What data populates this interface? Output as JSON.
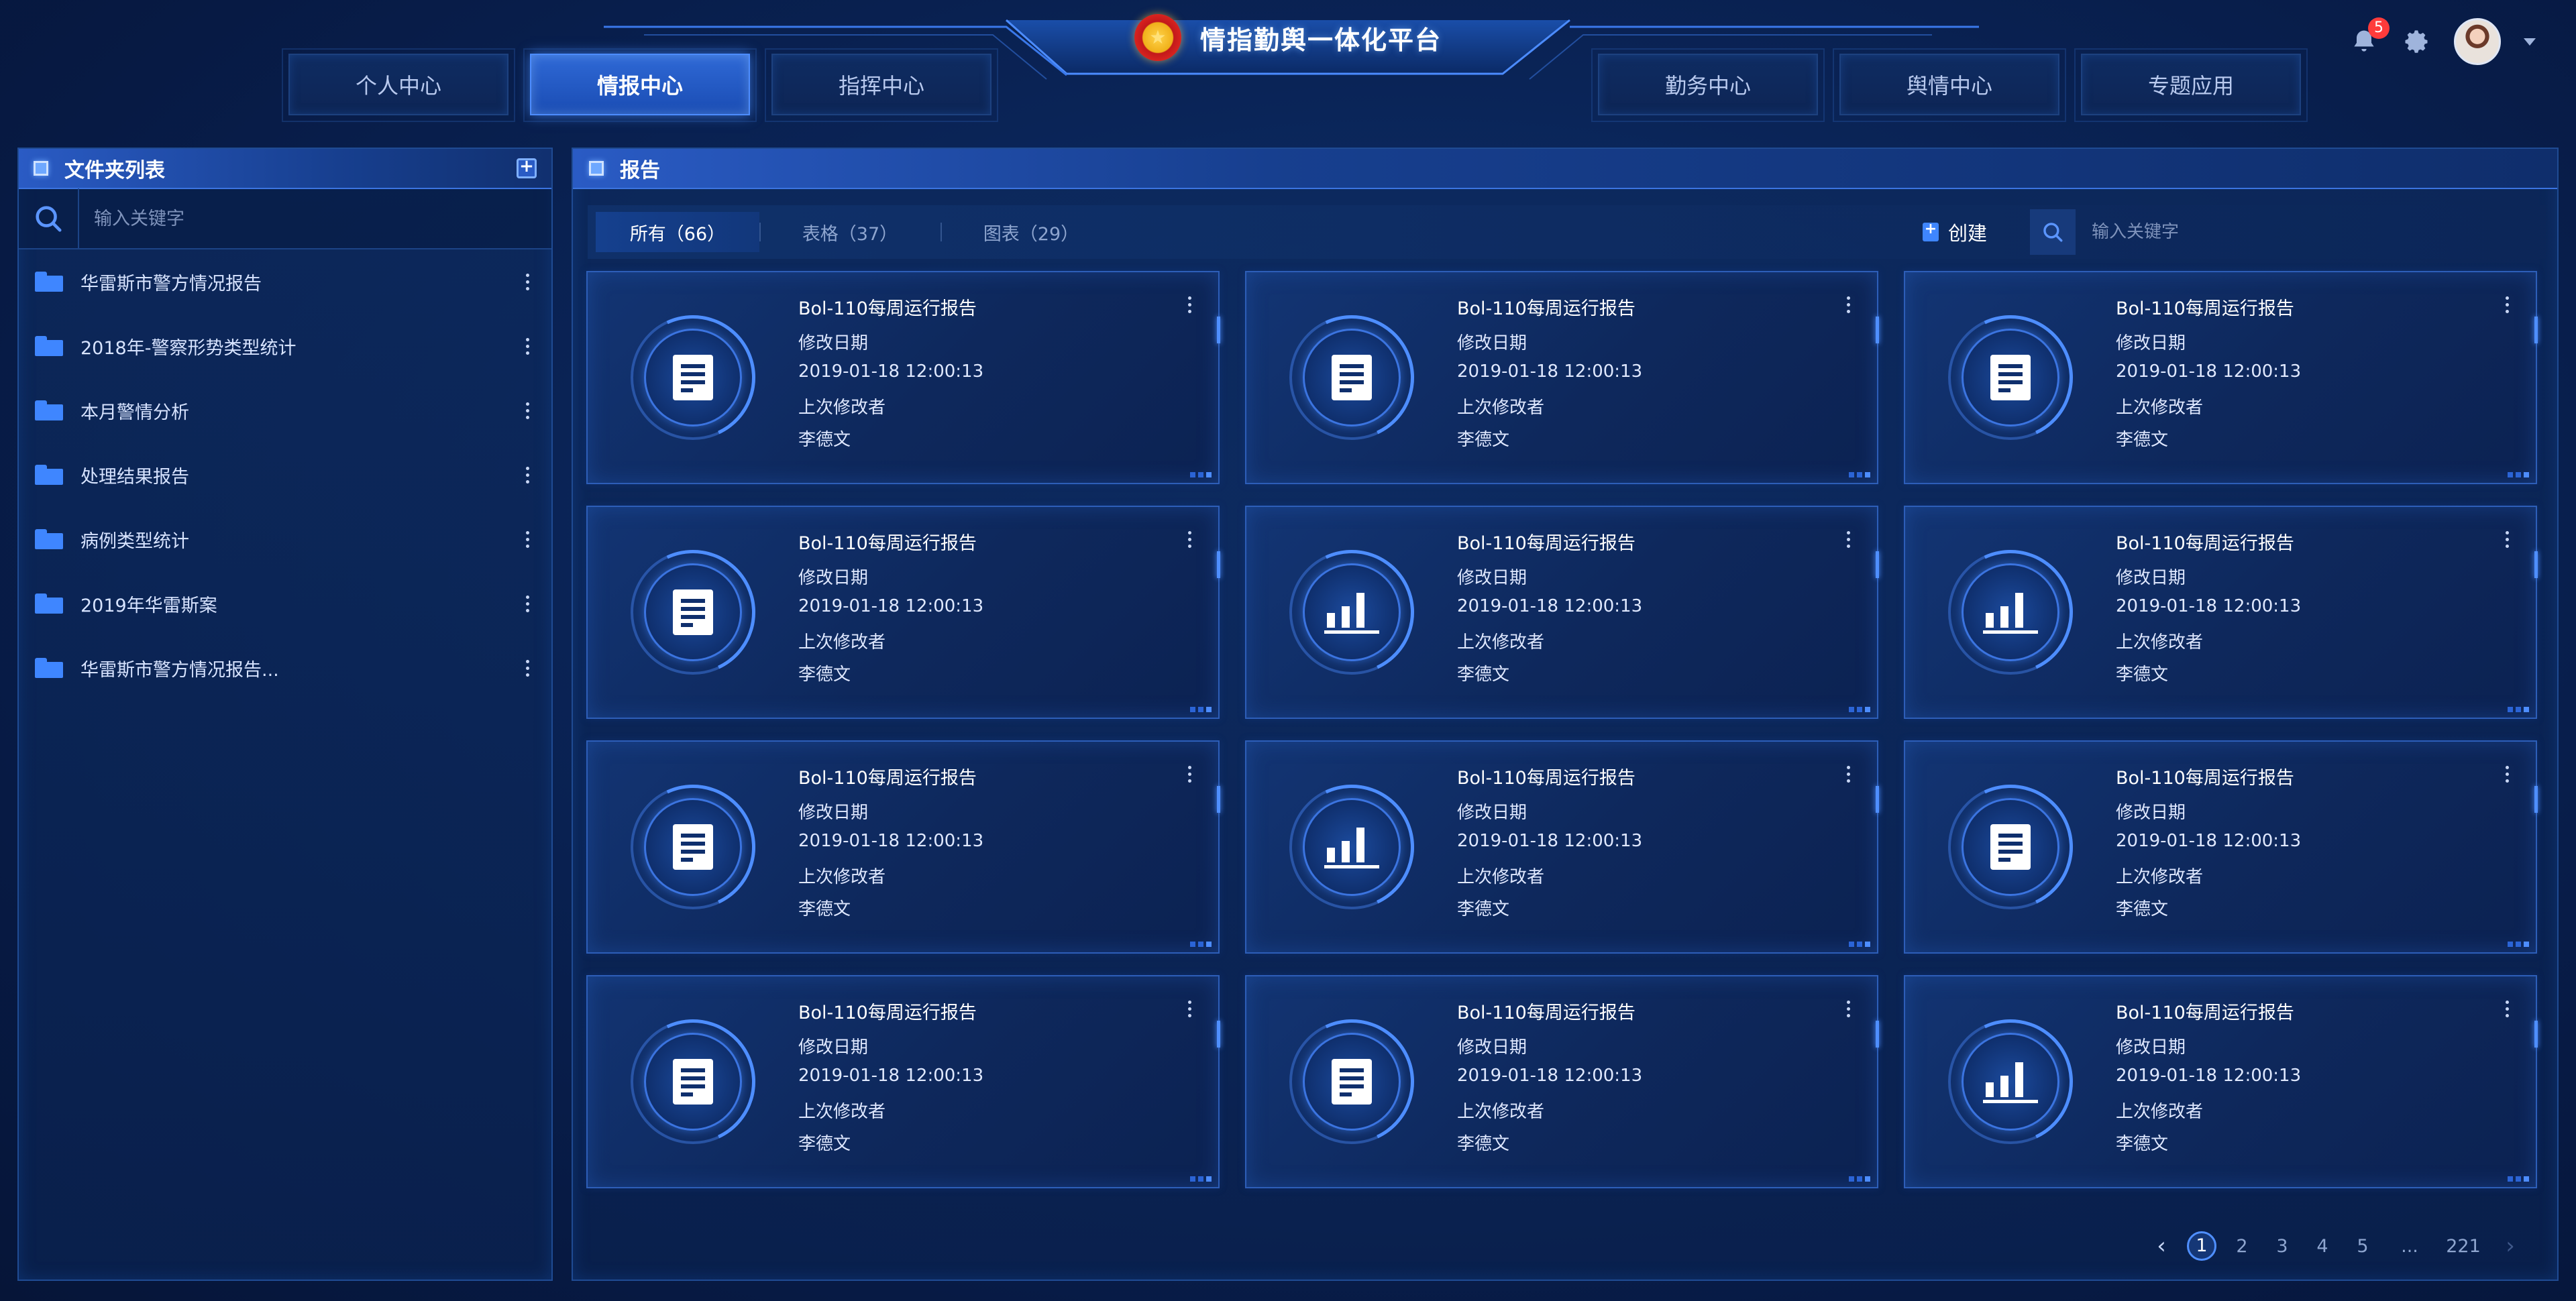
{
  "header": {
    "title": "情指勤舆一体化平台",
    "nav_left": [
      "个人中心",
      "情报中心",
      "指挥中心"
    ],
    "nav_right": [
      "勤务中心",
      "舆情中心",
      "专题应用"
    ],
    "active_nav": "情报中心",
    "notification_count": "5",
    "icons": [
      "emblem-icon",
      "bell-icon",
      "gear-icon",
      "avatar",
      "chevron-down-icon"
    ]
  },
  "sidebar": {
    "title": "文件夹列表",
    "search_placeholder": "输入关键字",
    "folders": [
      {
        "name": "华雷斯市警方情况报告"
      },
      {
        "name": "2018年-警察形势类型统计"
      },
      {
        "name": "本月警情分析"
      },
      {
        "name": "处理结果报告"
      },
      {
        "name": "病例类型统计"
      },
      {
        "name": "2019年华雷斯案"
      },
      {
        "name": "华雷斯市警方情况报告..."
      }
    ]
  },
  "main": {
    "title": "报告",
    "tabs": [
      {
        "label": "所有（66）",
        "active": true
      },
      {
        "label": "表格（37）",
        "active": false
      },
      {
        "label": "图表（29）",
        "active": false
      }
    ],
    "create_label": "创建",
    "search_placeholder": "输入关键字",
    "cards": [
      {
        "title": "Bol-110每周运行报告",
        "date_label": "修改日期",
        "date": "2019-01-18 12:00:13",
        "editor_label": "上次修改者",
        "editor": "李德文",
        "icon": "document-icon"
      },
      {
        "title": "Bol-110每周运行报告",
        "date_label": "修改日期",
        "date": "2019-01-18 12:00:13",
        "editor_label": "上次修改者",
        "editor": "李德文",
        "icon": "document-icon"
      },
      {
        "title": "Bol-110每周运行报告",
        "date_label": "修改日期",
        "date": "2019-01-18 12:00:13",
        "editor_label": "上次修改者",
        "editor": "李德文",
        "icon": "document-icon"
      },
      {
        "title": "Bol-110每周运行报告",
        "date_label": "修改日期",
        "date": "2019-01-18 12:00:13",
        "editor_label": "上次修改者",
        "editor": "李德文",
        "icon": "document-icon"
      },
      {
        "title": "Bol-110每周运行报告",
        "date_label": "修改日期",
        "date": "2019-01-18 12:00:13",
        "editor_label": "上次修改者",
        "editor": "李德文",
        "icon": "bar-chart-icon"
      },
      {
        "title": "Bol-110每周运行报告",
        "date_label": "修改日期",
        "date": "2019-01-18 12:00:13",
        "editor_label": "上次修改者",
        "editor": "李德文",
        "icon": "bar-chart-icon"
      },
      {
        "title": "Bol-110每周运行报告",
        "date_label": "修改日期",
        "date": "2019-01-18 12:00:13",
        "editor_label": "上次修改者",
        "editor": "李德文",
        "icon": "document-icon"
      },
      {
        "title": "Bol-110每周运行报告",
        "date_label": "修改日期",
        "date": "2019-01-18 12:00:13",
        "editor_label": "上次修改者",
        "editor": "李德文",
        "icon": "bar-chart-icon"
      },
      {
        "title": "Bol-110每周运行报告",
        "date_label": "修改日期",
        "date": "2019-01-18 12:00:13",
        "editor_label": "上次修改者",
        "editor": "李德文",
        "icon": "document-icon"
      },
      {
        "title": "Bol-110每周运行报告",
        "date_label": "修改日期",
        "date": "2019-01-18 12:00:13",
        "editor_label": "上次修改者",
        "editor": "李德文",
        "icon": "document-icon"
      },
      {
        "title": "Bol-110每周运行报告",
        "date_label": "修改日期",
        "date": "2019-01-18 12:00:13",
        "editor_label": "上次修改者",
        "editor": "李德文",
        "icon": "document-icon"
      },
      {
        "title": "Bol-110每周运行报告",
        "date_label": "修改日期",
        "date": "2019-01-18 12:00:13",
        "editor_label": "上次修改者",
        "editor": "李德文",
        "icon": "bar-chart-icon"
      }
    ],
    "pagination": {
      "pages": [
        "1",
        "2",
        "3",
        "4",
        "5",
        "...",
        "221"
      ],
      "current": "1"
    }
  },
  "colors": {
    "accent": "#4f8fff",
    "background": "#0a2457",
    "badge": "#ff3b3b",
    "active_tab": "#2f69d6"
  }
}
